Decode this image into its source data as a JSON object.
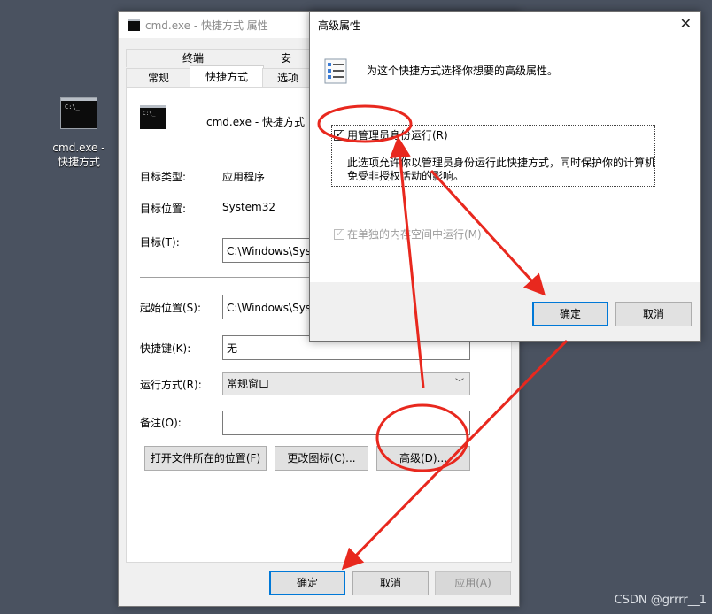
{
  "desktop": {
    "icon_label": "cmd.exe - 快捷方式",
    "watermark": "CSDN @grrrr__1"
  },
  "props_window": {
    "title": "cmd.exe - 快捷方式 属性",
    "tabs_row1": [
      "终端",
      "安"
    ],
    "tabs_row2": [
      "常规",
      "快捷方式",
      "选项"
    ],
    "active_tab": "快捷方式",
    "shortcut_name": "cmd.exe - 快捷方式",
    "target_type_label": "目标类型:",
    "target_type_value": "应用程序",
    "target_location_label": "目标位置:",
    "target_location_value": "System32",
    "target_label": "目标(T):",
    "target_value": "C:\\Windows\\System32\\cmd.exe",
    "start_in_label": "起始位置(S):",
    "start_in_value": "C:\\Windows\\System32",
    "hotkey_label": "快捷键(K):",
    "hotkey_value": "无",
    "run_label": "运行方式(R):",
    "run_value": "常规窗口",
    "comment_label": "备注(O):",
    "comment_value": "",
    "open_location_button": "打开文件所在的位置(F)",
    "change_icon_button": "更改图标(C)...",
    "advanced_button": "高级(D)...",
    "ok_button": "确定",
    "cancel_button": "取消",
    "apply_button": "应用(A)"
  },
  "advanced_dialog": {
    "title": "高级属性",
    "close_glyph": "✕",
    "description": "为这个快捷方式选择你想要的高级属性。",
    "run_as_admin_label": "用管理员身份运行(R)",
    "run_as_admin_checked": true,
    "run_as_admin_help_line1": "此选项允许你以管理员身份运行此快捷方式，同时保护你的计算机",
    "run_as_admin_help_line2": "免受非授权活动的影响。",
    "separate_memory_label": "在单独的内存空间中运行(M)",
    "separate_memory_checked": true,
    "ok_button": "确定",
    "cancel_button": "取消"
  },
  "annotation_color": "#e8281e"
}
